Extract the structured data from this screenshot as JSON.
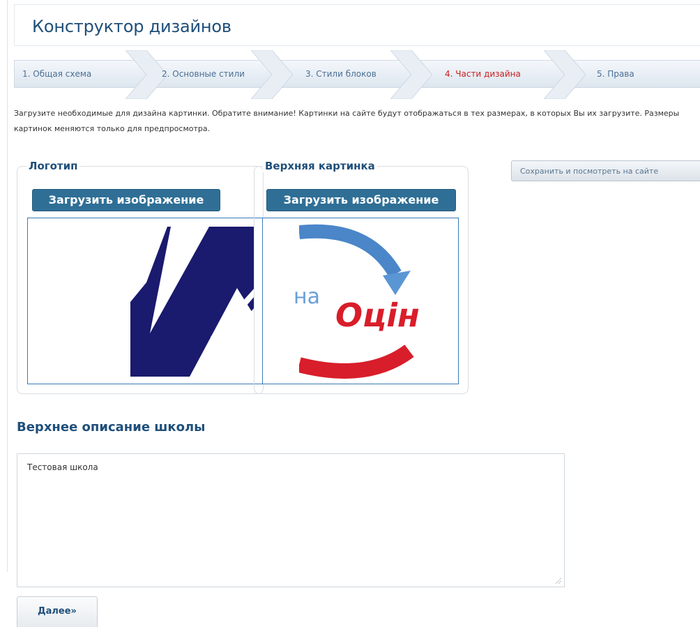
{
  "header": {
    "title": "Конструктор дизайнов"
  },
  "steps": [
    {
      "label": "1. Общая схема",
      "active": false
    },
    {
      "label": "2. Основные стили",
      "active": false
    },
    {
      "label": "3. Стили блоков",
      "active": false
    },
    {
      "label": "4. Части дизайна",
      "active": true
    },
    {
      "label": "5. Права",
      "active": false
    }
  ],
  "intro": {
    "text": "Загрузите необходимые для дизайна картинки. Обратите внимание! Картинки на сайте будут отображаться в тех размерах, в которых Вы их загрузите. Размеры картинок меняются только для предпросмотра."
  },
  "logo": {
    "legend": "Логотип",
    "upload_label": "Загрузить изображение"
  },
  "top_image": {
    "legend": "Верхняя картинка",
    "upload_label": "Загрузить изображение",
    "image_text": "Оцін",
    "image_prefix": "на"
  },
  "save": {
    "label": "Сохранить и посмотреть на сайте"
  },
  "description": {
    "title": "Верхнее описание школы",
    "value": "Тестовая школа"
  },
  "next": {
    "label": "Далее»"
  },
  "colors": {
    "accent": "#1f4f7a",
    "active_step": "#c81e1e",
    "button": "#2f6f96",
    "logo_navy": "#1a1a6e",
    "brand_red": "#d81e2a",
    "brand_blue": "#4a86c8"
  }
}
